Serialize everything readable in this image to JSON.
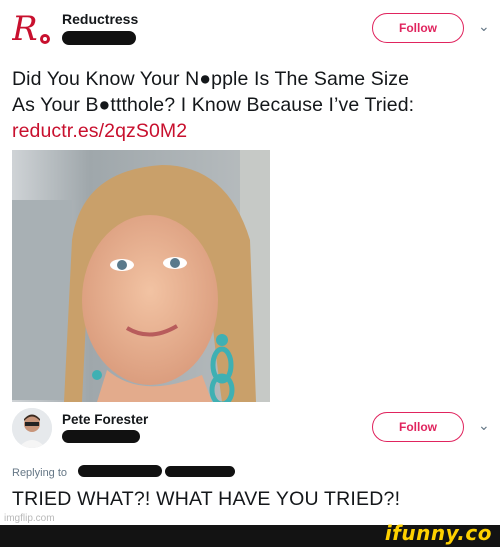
{
  "tweet": {
    "author_name": "Reductress",
    "follow_label": "Follow",
    "text_line1": "Did You Know Your N●pple Is The Same Size",
    "text_line2": "As Your B●ttthole? I Know Because I’ve Tried:",
    "link": "reductr.es/2qzS0M2"
  },
  "reply": {
    "author_name": "Pete Forester",
    "follow_label": "Follow",
    "replying_to_label": "Replying to",
    "text": "TRIED WHAT?! WHAT HAVE YOU TRIED?!"
  },
  "watermarks": {
    "imgflip": "imgflip.com",
    "ifunny": "ifunny.co"
  },
  "colors": {
    "brand_red": "#c8102e",
    "follow_pink": "#e0245e",
    "ifunny_yellow": "#ffd100"
  },
  "icons": {
    "logo": "reductress-logo-icon",
    "chevron": "chevron-down-icon"
  }
}
